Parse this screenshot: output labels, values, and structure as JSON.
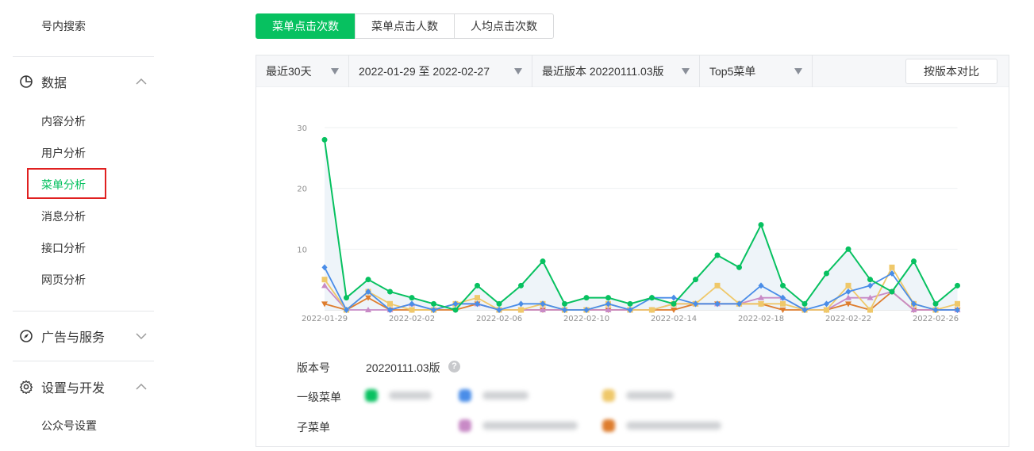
{
  "sidebar": {
    "top_link": "号内搜索",
    "data_group": {
      "label": "数据",
      "icon": "pie-chart-icon"
    },
    "data_items": [
      "内容分析",
      "用户分析",
      "菜单分析",
      "消息分析",
      "接口分析",
      "网页分析"
    ],
    "active_item": "菜单分析",
    "ads_group": {
      "label": "广告与服务",
      "icon": "compass-icon"
    },
    "settings_group": {
      "label": "设置与开发",
      "icon": "gear-icon"
    },
    "settings_items": [
      "公众号设置"
    ]
  },
  "tabs": [
    "菜单点击次数",
    "菜单点击人数",
    "人均点击次数"
  ],
  "selected_tab": "菜单点击次数",
  "filters": {
    "range": "最近30天",
    "date_range": "2022-01-29 至 2022-02-27",
    "version": "最近版本 20220111.03版",
    "topn": "Top5菜单",
    "compare_button": "按版本对比"
  },
  "legend": {
    "version_label": "版本号",
    "version_value": "20220111.03版",
    "level1_label": "一级菜单",
    "sub_label": "子菜单"
  },
  "colors": {
    "accent": "#07c160",
    "series": [
      "#07c160",
      "#4a8de8",
      "#efc86a",
      "#c88ac6",
      "#de7d2e"
    ]
  },
  "chart_data": {
    "type": "line",
    "x": [
      "2022-01-29",
      "2022-01-30",
      "2022-01-31",
      "2022-02-01",
      "2022-02-02",
      "2022-02-03",
      "2022-02-04",
      "2022-02-05",
      "2022-02-06",
      "2022-02-07",
      "2022-02-08",
      "2022-02-09",
      "2022-02-10",
      "2022-02-11",
      "2022-02-12",
      "2022-02-13",
      "2022-02-14",
      "2022-02-15",
      "2022-02-16",
      "2022-02-17",
      "2022-02-18",
      "2022-02-19",
      "2022-02-20",
      "2022-02-21",
      "2022-02-22",
      "2022-02-23",
      "2022-02-24",
      "2022-02-25",
      "2022-02-26",
      "2022-02-27"
    ],
    "x_tick_labels": [
      "2022-01-29",
      "2022-02-02",
      "2022-02-06",
      "2022-02-10",
      "2022-02-14",
      "2022-02-18",
      "2022-02-22",
      "2022-02-26"
    ],
    "y_ticks": [
      10,
      20,
      30
    ],
    "ylim": [
      0,
      30
    ],
    "series": [
      {
        "marker": "circle",
        "values": [
          28,
          2,
          5,
          3,
          2,
          1,
          0,
          4,
          1,
          4,
          8,
          1,
          2,
          2,
          1,
          2,
          1,
          5,
          9,
          7,
          14,
          4,
          1,
          6,
          10,
          5,
          3,
          8,
          1,
          4
        ]
      },
      {
        "marker": "diamond",
        "values": [
          7,
          0,
          3,
          0,
          1,
          0,
          1,
          1,
          0,
          1,
          1,
          0,
          0,
          1,
          0,
          2,
          2,
          1,
          1,
          1,
          4,
          2,
          0,
          1,
          3,
          4,
          6,
          1,
          0,
          0
        ]
      },
      {
        "marker": "square",
        "values": [
          5,
          0,
          3,
          1,
          0,
          0,
          1,
          2,
          0,
          0,
          1,
          0,
          0,
          1,
          0,
          0,
          1,
          1,
          4,
          1,
          1,
          1,
          0,
          0,
          4,
          0,
          7,
          1,
          0,
          1
        ]
      },
      {
        "marker": "triangle-up",
        "values": [
          4,
          0,
          0,
          0,
          1,
          0,
          1,
          1,
          0,
          0,
          0,
          0,
          0,
          0,
          0,
          0,
          1,
          1,
          1,
          1,
          2,
          2,
          0,
          0,
          2,
          2,
          3,
          0,
          0,
          0
        ]
      },
      {
        "marker": "triangle-down",
        "values": [
          1,
          0,
          2,
          0,
          0,
          0,
          0,
          1,
          0,
          0,
          0,
          0,
          0,
          0,
          0,
          0,
          0,
          1,
          1,
          1,
          1,
          0,
          0,
          0,
          1,
          0,
          3,
          0,
          0,
          0
        ]
      }
    ]
  }
}
